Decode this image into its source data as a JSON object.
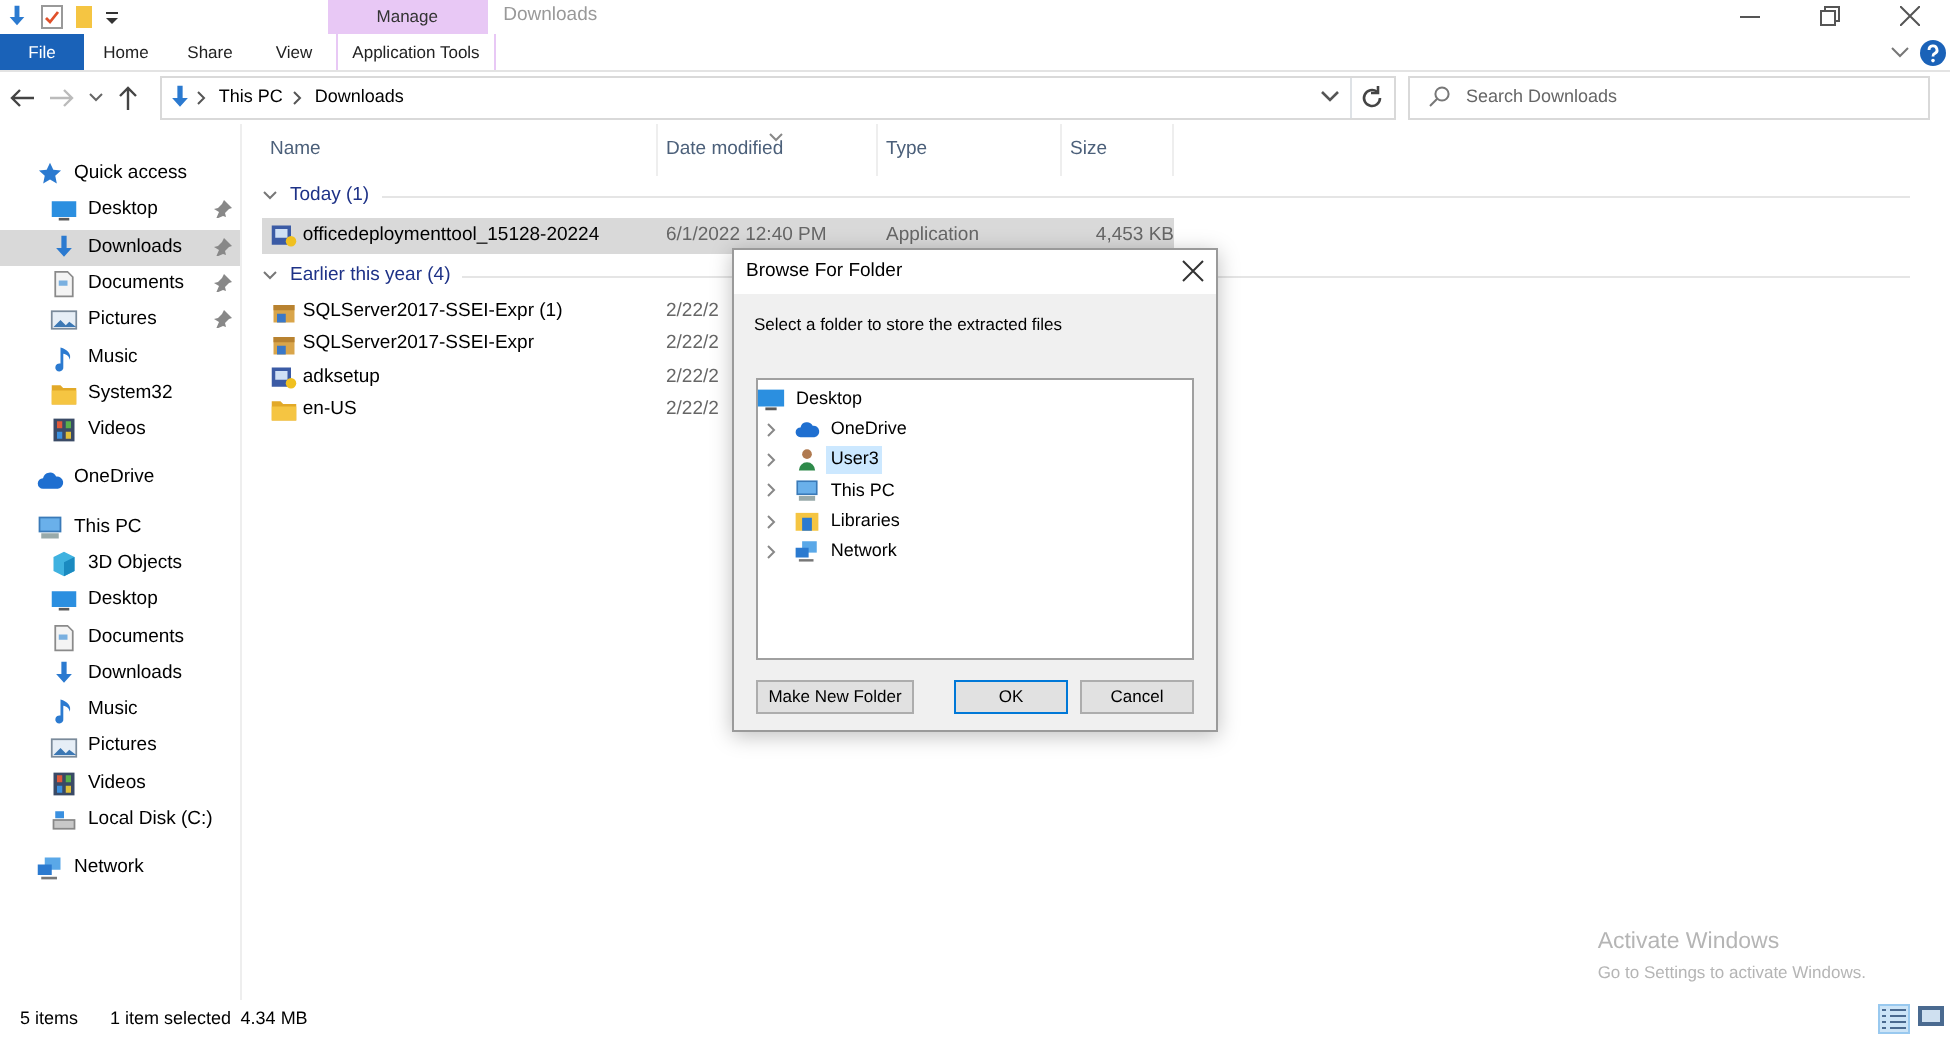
{
  "window": {
    "title": "Downloads"
  },
  "ribbon": {
    "context_group": "Manage",
    "tabs": [
      {
        "label": "File",
        "kind": "file"
      },
      {
        "label": "Home",
        "kind": "plain"
      },
      {
        "label": "Share",
        "kind": "plain"
      },
      {
        "label": "View",
        "kind": "plain"
      },
      {
        "label": "Application Tools",
        "kind": "contextual"
      }
    ]
  },
  "address": {
    "path": [
      "This PC",
      "Downloads"
    ],
    "search_placeholder": "Search Downloads"
  },
  "sidebar": {
    "items": [
      {
        "label": "Quick access",
        "selected": false,
        "children": [
          {
            "label": "Desktop",
            "pinned": true,
            "selected": false
          },
          {
            "label": "Downloads",
            "pinned": true,
            "selected": true
          },
          {
            "label": "Documents",
            "pinned": true,
            "selected": false
          },
          {
            "label": "Pictures",
            "pinned": true,
            "selected": false
          },
          {
            "label": "Music",
            "pinned": false,
            "selected": false
          },
          {
            "label": "System32",
            "pinned": false,
            "selected": false
          },
          {
            "label": "Videos",
            "pinned": false,
            "selected": false
          }
        ]
      },
      {
        "label": "OneDrive",
        "selected": false
      },
      {
        "label": "This PC",
        "selected": false,
        "children": [
          {
            "label": "3D Objects",
            "selected": false
          },
          {
            "label": "Desktop",
            "selected": false
          },
          {
            "label": "Documents",
            "selected": false
          },
          {
            "label": "Downloads",
            "selected": false
          },
          {
            "label": "Music",
            "selected": false
          },
          {
            "label": "Pictures",
            "selected": false
          },
          {
            "label": "Videos",
            "selected": false
          },
          {
            "label": "Local Disk (C:)",
            "selected": false
          }
        ]
      },
      {
        "label": "Network",
        "selected": false
      }
    ]
  },
  "file_list": {
    "columns": [
      {
        "label": "Name",
        "sorted": false
      },
      {
        "label": "Date modified",
        "sorted": true
      },
      {
        "label": "Type",
        "sorted": false
      },
      {
        "label": "Size",
        "sorted": false
      }
    ],
    "groups": [
      {
        "label": "Today (1)",
        "expanded": true,
        "files": [
          {
            "name": "officedeploymenttool_15128-20224",
            "date": "6/1/2022 12:40 PM",
            "type": "Application",
            "size": "4,453 KB",
            "selected": true
          }
        ]
      },
      {
        "label": "Earlier this year (4)",
        "expanded": true,
        "files": [
          {
            "name": "SQLServer2017-SSEI-Expr (1)",
            "date": "2/22/2",
            "selected": false
          },
          {
            "name": "SQLServer2017-SSEI-Expr",
            "date": "2/22/2",
            "selected": false
          },
          {
            "name": "adksetup",
            "date": "2/22/2",
            "selected": false
          },
          {
            "name": "en-US",
            "date": "2/22/2",
            "selected": false
          }
        ]
      }
    ]
  },
  "dialog": {
    "title": "Browse For Folder",
    "prompt": "Select a folder to store the extracted files",
    "tree": {
      "label": "Desktop",
      "selected": false,
      "children": [
        {
          "label": "OneDrive",
          "selected": false
        },
        {
          "label": "User3",
          "selected": true
        },
        {
          "label": "This PC",
          "selected": false
        },
        {
          "label": "Libraries",
          "selected": false
        },
        {
          "label": "Network",
          "selected": false
        }
      ]
    },
    "buttons": [
      {
        "label": "Make New Folder",
        "default": false
      },
      {
        "label": "OK",
        "default": true
      },
      {
        "label": "Cancel",
        "default": false
      }
    ]
  },
  "watermark_os": {
    "title": "Activate Windows",
    "subtitle": "Go to Settings to activate Windows."
  },
  "status_bar": {
    "item_count": "5 items",
    "selection": "1 item selected",
    "selection_size": "4.34 MB",
    "views": [
      {
        "kind": "details",
        "selected": true
      },
      {
        "kind": "large_icons",
        "selected": false
      }
    ]
  }
}
